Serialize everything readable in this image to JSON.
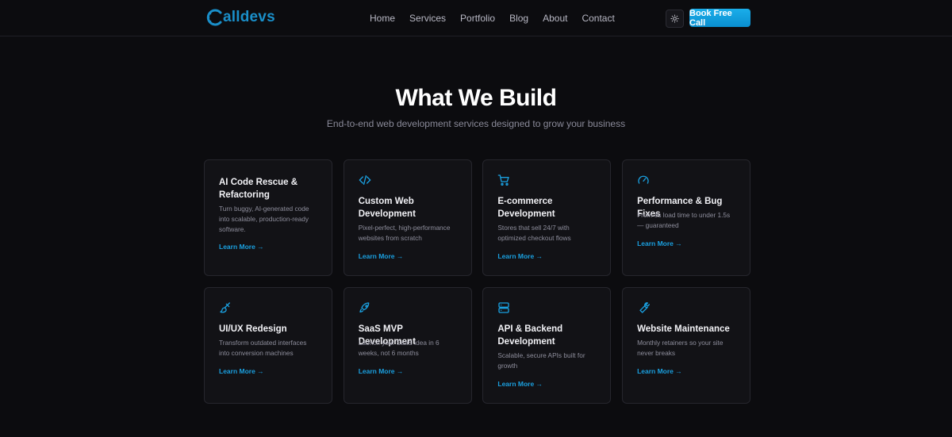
{
  "brand": {
    "name": "alldevs",
    "accent": "#1a8fc9"
  },
  "nav": {
    "items": [
      "Home",
      "Services",
      "Portfolio",
      "Blog",
      "About",
      "Contact"
    ],
    "theme_icon": "sun-icon",
    "cta_label": "Book Free Call"
  },
  "hero": {
    "title": "What We Build",
    "subtitle": "End-to-end web development services designed to grow your business"
  },
  "cards": [
    {
      "icon": "code-rescue-icon",
      "title": "AI Code Rescue & Refactoring",
      "desc": "Turn buggy, AI-generated code into scalable, production-ready software.",
      "link": "Learn More →"
    },
    {
      "icon": "code-icon",
      "title": "Custom Web Development",
      "desc": "Pixel-perfect, high-performance websites from scratch",
      "link": "Learn More →"
    },
    {
      "icon": "cart-icon",
      "title": "E-commerce Development",
      "desc": "Stores that sell 24/7 with optimized checkout flows",
      "link": "Learn More →"
    },
    {
      "icon": "gauge-icon",
      "title": "Performance & Bug Fixes",
      "desc": "From 8s load time to under 1.5s — guaranteed",
      "link": "Learn More →"
    },
    {
      "icon": "brush-icon",
      "title": "UI/UX Redesign",
      "desc": "Transform outdated interfaces into conversion machines",
      "link": "Learn More →"
    },
    {
      "icon": "rocket-icon",
      "title": "SaaS MVP Development",
      "desc": "Launch your SaaS idea in 6 weeks, not 6 months",
      "link": "Learn More →"
    },
    {
      "icon": "server-icon",
      "title": "API & Backend Development",
      "desc": "Scalable, secure APIs built for growth",
      "link": "Learn More →"
    },
    {
      "icon": "wrench-icon",
      "title": "Website Maintenance",
      "desc": "Monthly retainers so your site never breaks",
      "link": "Learn More →"
    }
  ]
}
